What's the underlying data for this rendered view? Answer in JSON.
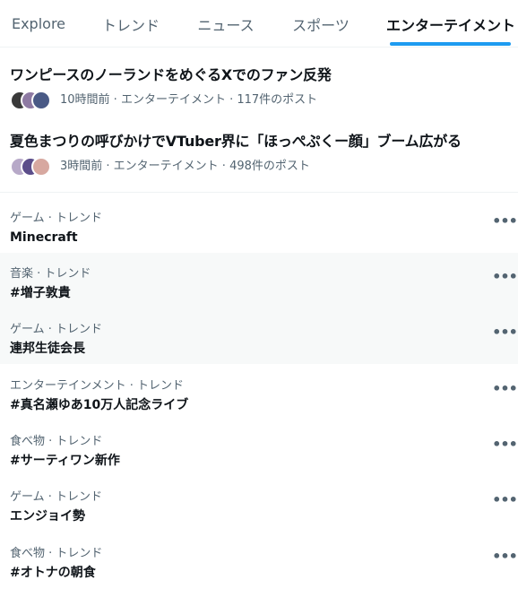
{
  "tabs": [
    {
      "label": "Explore",
      "active": false
    },
    {
      "label": "トレンド",
      "active": false
    },
    {
      "label": "ニュース",
      "active": false
    },
    {
      "label": "スポーツ",
      "active": false
    },
    {
      "label": "エンターテイメント",
      "active": true
    }
  ],
  "news": [
    {
      "title": "ワンピースのノーランドをめぐるXでのファン反発",
      "meta": "10時間前 · エンターテイメント · 117件のポスト",
      "avatar_colors": [
        "#3a3a3a",
        "#8e7aa3",
        "#4a5a86"
      ]
    },
    {
      "title": "夏色まつりの呼びかけでVTuber界に「ほっぺぷくー顔」ブーム広がる",
      "meta": "3時間前 · エンターテイメント · 498件のポスト",
      "avatar_colors": [
        "#b7a9c8",
        "#5b4d8a",
        "#d7a8a0"
      ]
    }
  ],
  "trends": [
    {
      "context": "ゲーム · トレンド",
      "name": "Minecraft"
    },
    {
      "context": "音楽 · トレンド",
      "name": "#増子敦貴"
    },
    {
      "context": "ゲーム · トレンド",
      "name": "連邦生徒会長"
    },
    {
      "context": "エンターテインメント · トレンド",
      "name": "#真名瀬ゆあ10万人記念ライブ"
    },
    {
      "context": "食べ物 · トレンド",
      "name": "#サーティワン新作"
    },
    {
      "context": "ゲーム · トレンド",
      "name": "エンジョイ勢"
    },
    {
      "context": "食べ物 · トレンド",
      "name": "#オトナの朝食"
    }
  ],
  "more_label": "•••",
  "colors": {
    "accent": "#1d9bf0",
    "secondary_text": "#536471",
    "primary_text": "#0f1419"
  }
}
